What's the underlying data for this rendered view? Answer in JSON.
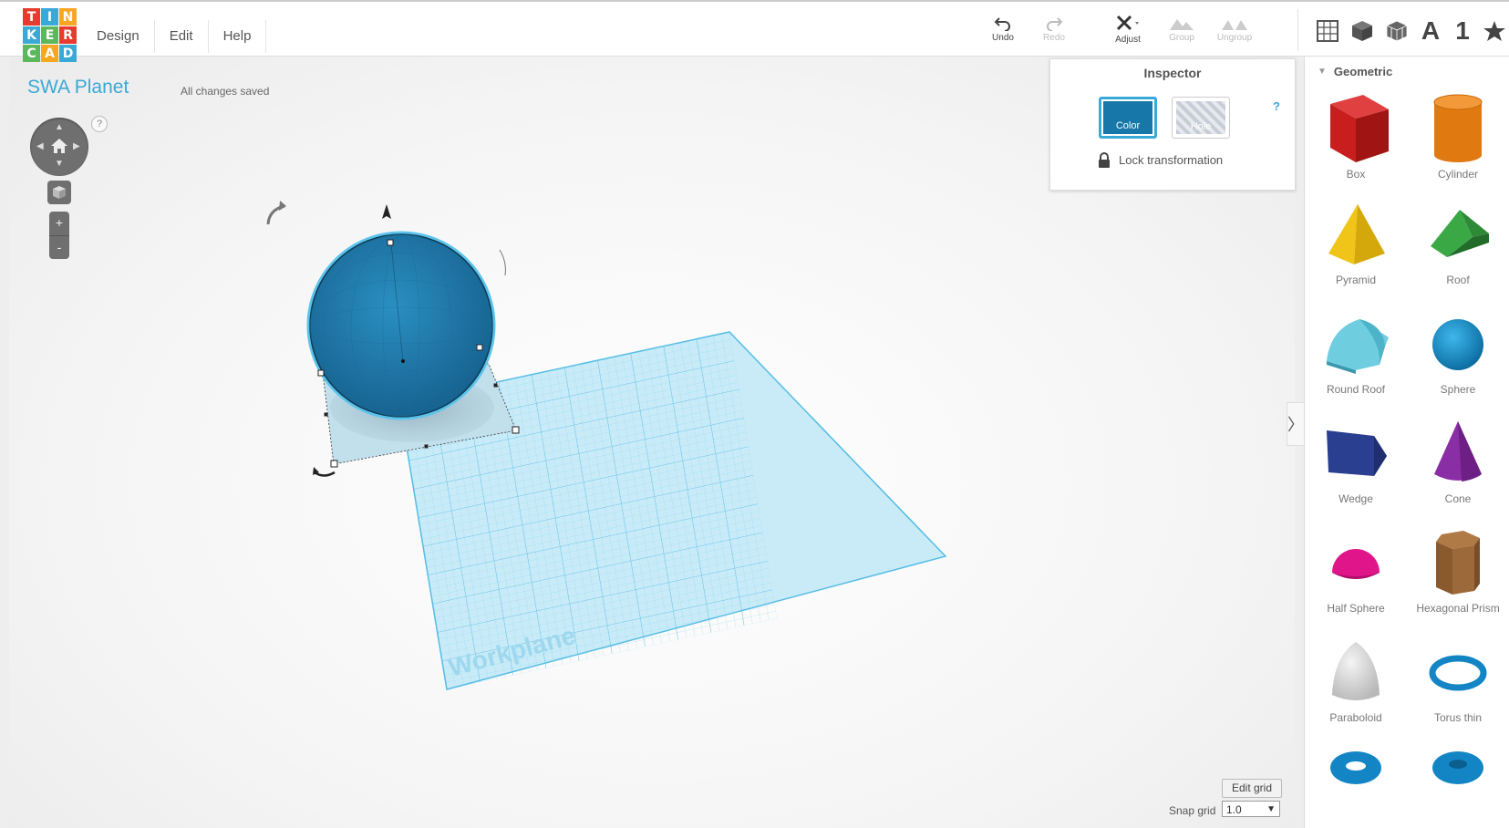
{
  "logo": {
    "letters": [
      "T",
      "I",
      "N",
      "K",
      "E",
      "R",
      "C",
      "A",
      "D"
    ],
    "colors": [
      "#e83a2e",
      "#3aa9d6",
      "#f5a623",
      "#3aa9d6",
      "#5cb85c",
      "#e83a2e",
      "#5cb85c",
      "#f5a623",
      "#3aa9d6"
    ]
  },
  "menu": {
    "design": "Design",
    "edit": "Edit",
    "help": "Help"
  },
  "toolbar": {
    "undo": "Undo",
    "redo": "Redo",
    "adjust": "Adjust",
    "group": "Group",
    "ungroup": "Ungroup"
  },
  "view_toolbar": {
    "text_shape": "A",
    "number_shape": "1"
  },
  "project": {
    "title": "SWA Planet",
    "save_status": "All changes saved"
  },
  "nav": {
    "help": "?",
    "zoom_in": "+",
    "zoom_out": "-"
  },
  "workplane": {
    "label": "Workplane"
  },
  "inspector": {
    "title": "Inspector",
    "help": "?",
    "color_label": "Color",
    "hole_label": "Hole",
    "lock_label": "Lock transformation",
    "selected_color": "#1677a8"
  },
  "sidebar": {
    "category": "Geometric",
    "shapes": [
      {
        "label": "Box"
      },
      {
        "label": "Cylinder"
      },
      {
        "label": "Pyramid"
      },
      {
        "label": "Roof"
      },
      {
        "label": "Round Roof"
      },
      {
        "label": "Sphere"
      },
      {
        "label": "Wedge"
      },
      {
        "label": "Cone"
      },
      {
        "label": "Half Sphere"
      },
      {
        "label": "Hexagonal Prism"
      },
      {
        "label": "Paraboloid"
      },
      {
        "label": "Torus thin"
      },
      {
        "label": ""
      },
      {
        "label": ""
      }
    ]
  },
  "grid_controls": {
    "edit_grid": "Edit grid",
    "snap_label": "Snap grid",
    "snap_value": "1.0"
  },
  "colors": {
    "accent": "#3aa9d6",
    "sphere": "#1f7fb0",
    "workplane": "#bfe6f5"
  }
}
